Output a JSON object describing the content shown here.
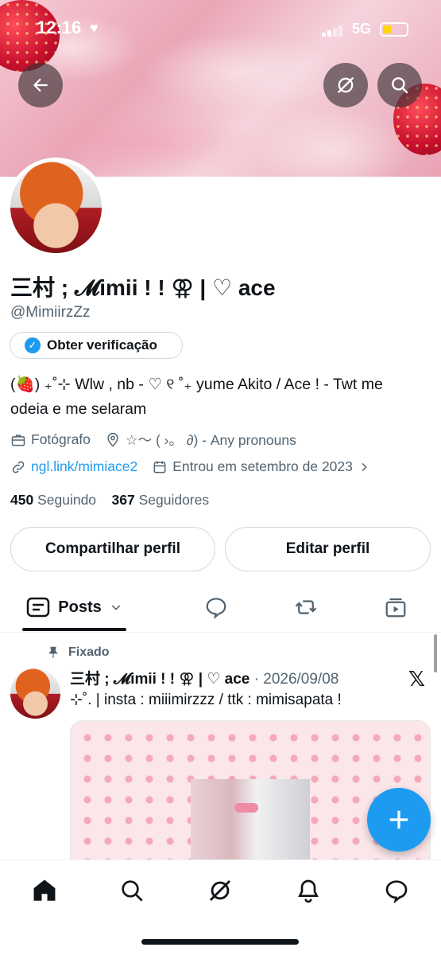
{
  "status_bar": {
    "time": "12:16",
    "network": "5G"
  },
  "header": {
    "back_icon": "arrow-left-icon",
    "grok_icon": "grok-icon",
    "search_icon": "search-icon"
  },
  "profile": {
    "display_name": "三村 ; 𝓜imii ! ! ⚢ | ♡ ace",
    "handle": "@MimiirzZz",
    "verify_label": "Obter verificação",
    "bio_line1": "(🍓) ₊˚⊹ Wlw , nb - ♡ ୧ ˚₊ yume Akito / Ace ! - Twt me",
    "bio_line2": "odeia e me selaram",
    "profession": "Fotógrafo",
    "location": "☆〜 ( ›。 ∂) - Any pronouns",
    "website": "ngl.link/mimiace2",
    "joined": "Entrou em setembro de 2023",
    "following_count": "450",
    "following_label": "Seguindo",
    "followers_count": "367",
    "followers_label": "Seguidores",
    "share_button": "Compartilhar perfil",
    "edit_button": "Editar perfil"
  },
  "tabs": {
    "posts_label": "Posts",
    "items": [
      "posts",
      "replies-icon",
      "reposts-icon",
      "media-icon"
    ]
  },
  "pinned_post": {
    "pinned_label": "Fixado",
    "author": "三村 ; 𝓜imii ! ! ⚢ | ♡ ace",
    "date": "· 2026/09/08",
    "text": "⊹˚. |  insta : miiimirzzz / ttk : mimisapata !",
    "source_icon": "x-logo-icon"
  },
  "bottom_nav": [
    "home-icon",
    "search-icon",
    "grok-icon",
    "notifications-icon",
    "messages-icon"
  ],
  "colors": {
    "accent": "#1d9bf0",
    "text": "#0f1419",
    "secondary": "#536471",
    "battery": "#ffd60a"
  }
}
